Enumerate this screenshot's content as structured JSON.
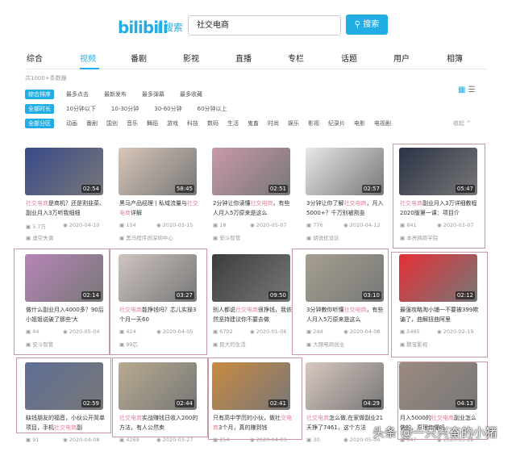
{
  "header": {
    "logo": "bilibili",
    "logo_suffix": "| 搜索",
    "search_value": "社交电商",
    "search_button": "搜索"
  },
  "tabs": [
    "综合",
    "视频",
    "番剧",
    "影视",
    "直播",
    "专栏",
    "话题",
    "用户",
    "相簿"
  ],
  "active_tab": "视频",
  "result_count": "共1000+条数据",
  "filters": {
    "order": {
      "selected": "综合排序",
      "options": [
        "最多点击",
        "最新发布",
        "最多弹幕",
        "最多收藏"
      ]
    },
    "duration": {
      "selected": "全部时长",
      "options": [
        "10分钟以下",
        "10-30分钟",
        "30-60分钟",
        "60分钟以上"
      ]
    },
    "zone": {
      "selected": "全部分区",
      "options": [
        "动画",
        "番剧",
        "国创",
        "音乐",
        "舞蹈",
        "游戏",
        "科技",
        "数码",
        "生活",
        "鬼畜",
        "时尚",
        "娱乐",
        "影视",
        "纪录片",
        "电影",
        "电视剧"
      ]
    },
    "collapse": "收起 ^"
  },
  "videos": [
    {
      "pre": "",
      "hl": "社交电商",
      "post": "是商机？还是割韭菜、副业月入3万听我细细",
      "duration": "02:54",
      "plays": "5.7万",
      "date": "2020-04-10",
      "uploader": "虚空失调",
      "thumb": "#3a4a8a"
    },
    {
      "pre": "黑马产品经理丨私域流量与",
      "hl": "社交电商",
      "post": "详解",
      "duration": "58:45",
      "plays": "154",
      "date": "2020-03-15",
      "uploader": "黑马程序员深圳中心",
      "thumb": "#d8c6b8"
    },
    {
      "pre": "2分钟让你读懂",
      "hl": "社交电商",
      "post": "，有些人月入5万原来是这么",
      "duration": "02:51",
      "plays": "18",
      "date": "2020-05-07",
      "uploader": "安斗智管",
      "thumb": "#c89aa8"
    },
    {
      "pre": "3分钟让你了解",
      "hl": "社交电商",
      "post": "，月入5000+？千万别被割韭",
      "duration": "02:57",
      "plays": "776",
      "date": "2020-04-12",
      "uploader": "胡说优设论",
      "thumb": "#e8e8e8"
    },
    {
      "pre": "",
      "hl": "社交电商",
      "post": "副业月入3万详细教程2020版第一课：项目介",
      "duration": "05:47",
      "plays": "841",
      "date": "2020-03-07",
      "uploader": "本亮网商学院",
      "thumb": "#2b3345"
    },
    {
      "pre": "做什么副业月入4000多？90后小姐姐说破了那些'大",
      "hl": "",
      "post": "",
      "duration": "02:14",
      "plays": "44",
      "date": "2020-05-04",
      "uploader": "安斗智管",
      "thumb": "#b785b8"
    },
    {
      "pre": "",
      "hl": "社交电商",
      "post": "能挣钱吗？芯儿实操3个月一天60",
      "duration": "03:27",
      "plays": "424",
      "date": "2020-04-05",
      "uploader": "99芯",
      "thumb": "#cfc5c0"
    },
    {
      "pre": "别人都说",
      "hl": "社交电商",
      "post": "很挣钱，我依然坚持建议你不要去做",
      "duration": "09:50",
      "plays": "6702",
      "date": "2020-01-06",
      "uploader": "民大的生活",
      "thumb": "#3c3c3c"
    },
    {
      "pre": "3分钟教你听懂",
      "hl": "社交电商",
      "post": "，有些人月入5万原来是这么",
      "duration": "03:10",
      "plays": "244",
      "date": "2020-04-08",
      "uploader": "大刚电商创业",
      "thumb": "#a6a090"
    },
    {
      "pre": "最强攻略淘小铺一不要被399欺骗了，曲解扭曲阿里",
      "hl": "",
      "post": "",
      "duration": "02:12",
      "plays": "5465",
      "date": "2020-02-19",
      "uploader": "鹏宝影视",
      "thumb": "#e52f36"
    },
    {
      "pre": "缺钱朋友的福音，小伙公开简单项目，手机",
      "hl": "社交电商",
      "post": "副",
      "duration": "02:59",
      "plays": "91",
      "date": "2020-04-08",
      "uploader": "",
      "thumb": "#5e6e96"
    },
    {
      "pre": "",
      "hl": "社交电商",
      "post": "实战赚钱日收入200的方法，有人公然卖",
      "duration": "02:44",
      "plays": "4269",
      "date": "2020-03-27",
      "uploader": "",
      "thumb": "#b8aa90"
    },
    {
      "pre": "只有高中学历的小伙，做社",
      "hl": "交电商",
      "post": "3个月，真的赚到钱",
      "duration": "02:41",
      "plays": "254",
      "date": "2020-04-03",
      "uploader": "",
      "thumb": "#c98a40"
    },
    {
      "pre": "",
      "hl": "社交电商",
      "post": "怎么做,在家做副业21天挣了7461，这个方法",
      "duration": "04:29",
      "plays": "30",
      "date": "2020-05-04",
      "uploader": "",
      "thumb": "#d9c8c0"
    },
    {
      "pre": "月入5000的",
      "hl": "社交电商",
      "post": "副业怎么做的，原理你懂吗",
      "duration": "04:13",
      "plays": "647",
      "date": "2020-03-28",
      "uploader": "",
      "thumb": "#9b8a80"
    }
  ],
  "watermark": "头条 @一只兴奋的小猪"
}
